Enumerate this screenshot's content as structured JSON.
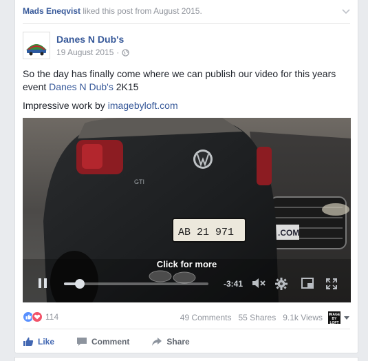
{
  "story": {
    "actor": "Mads Eneqvist",
    "action_text": " liked this post from August 2015."
  },
  "post": {
    "page_name": "Danes N Dub's",
    "avatar_text": "DANES N DUB'S",
    "date": "19 August 2015",
    "text_line1": "So the day has finally come where we can publish our video for this years event ",
    "text_link": "Danes N Dub's",
    "text_line1_end": " 2K15",
    "text_line2": "Impressive work by ",
    "text_line2_link": "imagebyloft.com"
  },
  "video": {
    "click_more_label": "Click for more",
    "duration": "-3:41",
    "progress": 0.11,
    "plate_text": "AB 21 971",
    "grille_text": ".COM"
  },
  "stats": {
    "reaction_count": "114",
    "comments": "49 Comments",
    "shares": "55 Shares",
    "views": "9.1k Views",
    "badge_line1": "IMAGE",
    "badge_line2": "BY",
    "badge_line3": "LOFT"
  },
  "actions": {
    "like": "Like",
    "comment": "Comment",
    "share": "Share"
  },
  "colors": {
    "link": "#365899",
    "like_blue": "#4267b2",
    "love_red": "#f25268",
    "muted": "#90949c"
  }
}
